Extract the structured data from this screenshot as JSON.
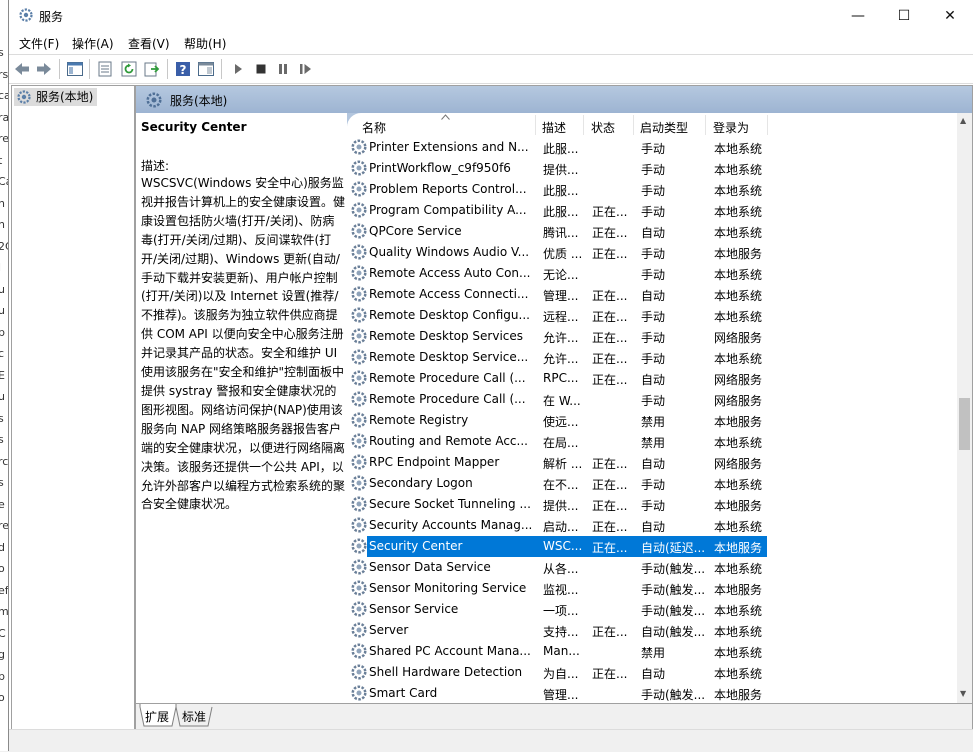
{
  "window": {
    "title": "服务",
    "minimize_glyph": "—",
    "maximize_glyph": "☐",
    "close_glyph": "✕"
  },
  "menu": [
    "文件(F)",
    "操作(A)",
    "查看(V)",
    "帮助(H)"
  ],
  "tree": {
    "root": "服务(本地)"
  },
  "panel": {
    "title": "服务(本地)"
  },
  "description": {
    "service_name": "Security Center",
    "label": "描述:",
    "text": "WSCSVC(Windows 安全中心)服务监视并报告计算机上的安全健康设置。健康设置包括防火墙(打开/关闭)、防病毒(打开/关闭/过期)、反间谍软件(打开/关闭/过期)、Windows 更新(自动/手动下载并安装更新)、用户帐户控制(打开/关闭)以及 Internet 设置(推荐/不推荐)。该服务为独立软件供应商提供 COM API 以便向安全中心服务注册并记录其产品的状态。安全和维护 UI 使用该服务在\"安全和维护\"控制面板中提供 systray 警报和安全健康状况的图形视图。网络访问保护(NAP)使用该服务向 NAP 网络策略服务器报告客户端的安全健康状况，以便进行网络隔离决策。该服务还提供一个公共 API，以允许外部客户以编程方式检索系统的聚合安全健康状况。"
  },
  "columns": {
    "name": "名称",
    "desc": "描述",
    "status": "状态",
    "startup": "启动类型",
    "logon": "登录为"
  },
  "services": [
    {
      "name": "Printer Extensions and N...",
      "desc": "此服...",
      "status": "",
      "startup": "手动",
      "logon": "本地系统"
    },
    {
      "name": "PrintWorkflow_c9f950f6",
      "desc": "提供...",
      "status": "",
      "startup": "手动",
      "logon": "本地系统"
    },
    {
      "name": "Problem Reports Control...",
      "desc": "此服...",
      "status": "",
      "startup": "手动",
      "logon": "本地系统"
    },
    {
      "name": "Program Compatibility A...",
      "desc": "此服...",
      "status": "正在...",
      "startup": "手动",
      "logon": "本地系统"
    },
    {
      "name": "QPCore Service",
      "desc": "腾讯...",
      "status": "正在...",
      "startup": "自动",
      "logon": "本地系统"
    },
    {
      "name": "Quality Windows Audio V...",
      "desc": "优质 ...",
      "status": "正在...",
      "startup": "手动",
      "logon": "本地服务"
    },
    {
      "name": "Remote Access Auto Con...",
      "desc": "无论...",
      "status": "",
      "startup": "手动",
      "logon": "本地系统"
    },
    {
      "name": "Remote Access Connecti...",
      "desc": "管理...",
      "status": "正在...",
      "startup": "自动",
      "logon": "本地系统"
    },
    {
      "name": "Remote Desktop Configu...",
      "desc": "远程...",
      "status": "正在...",
      "startup": "手动",
      "logon": "本地系统"
    },
    {
      "name": "Remote Desktop Services",
      "desc": "允许...",
      "status": "正在...",
      "startup": "手动",
      "logon": "网络服务"
    },
    {
      "name": "Remote Desktop Service...",
      "desc": "允许...",
      "status": "正在...",
      "startup": "手动",
      "logon": "本地系统"
    },
    {
      "name": "Remote Procedure Call (...",
      "desc": "RPC...",
      "status": "正在...",
      "startup": "自动",
      "logon": "网络服务"
    },
    {
      "name": "Remote Procedure Call (...",
      "desc": "在 W...",
      "status": "",
      "startup": "手动",
      "logon": "网络服务"
    },
    {
      "name": "Remote Registry",
      "desc": "使远...",
      "status": "",
      "startup": "禁用",
      "logon": "本地服务"
    },
    {
      "name": "Routing and Remote Acc...",
      "desc": "在局...",
      "status": "",
      "startup": "禁用",
      "logon": "本地系统"
    },
    {
      "name": "RPC Endpoint Mapper",
      "desc": "解析 ...",
      "status": "正在...",
      "startup": "自动",
      "logon": "网络服务"
    },
    {
      "name": "Secondary Logon",
      "desc": "在不...",
      "status": "正在...",
      "startup": "手动",
      "logon": "本地系统"
    },
    {
      "name": "Secure Socket Tunneling ...",
      "desc": "提供...",
      "status": "正在...",
      "startup": "手动",
      "logon": "本地服务"
    },
    {
      "name": "Security Accounts Manag...",
      "desc": "启动...",
      "status": "正在...",
      "startup": "自动",
      "logon": "本地系统"
    },
    {
      "name": "Security Center",
      "desc": "WSC...",
      "status": "正在...",
      "startup": "自动(延迟...",
      "logon": "本地服务"
    },
    {
      "name": "Sensor Data Service",
      "desc": "从各...",
      "status": "",
      "startup": "手动(触发...",
      "logon": "本地系统"
    },
    {
      "name": "Sensor Monitoring Service",
      "desc": "监视...",
      "status": "",
      "startup": "手动(触发...",
      "logon": "本地服务"
    },
    {
      "name": "Sensor Service",
      "desc": "一项...",
      "status": "",
      "startup": "手动(触发...",
      "logon": "本地系统"
    },
    {
      "name": "Server",
      "desc": "支持...",
      "status": "正在...",
      "startup": "自动(触发...",
      "logon": "本地系统"
    },
    {
      "name": "Shared PC Account Mana...",
      "desc": "Man...",
      "status": "",
      "startup": "禁用",
      "logon": "本地系统"
    },
    {
      "name": "Shell Hardware Detection",
      "desc": "为自...",
      "status": "正在...",
      "startup": "自动",
      "logon": "本地系统"
    },
    {
      "name": "Smart Card",
      "desc": "管理...",
      "status": "",
      "startup": "手动(触发...",
      "logon": "本地服务"
    }
  ],
  "selected_index": 19,
  "tabs": [
    "扩展",
    "标准"
  ],
  "left_edge_fragments": [
    "s",
    "rsi",
    "ca",
    "ra",
    "re",
    "t",
    "Ca",
    "h",
    "h",
    "2C",
    "l",
    "u",
    "u",
    "b",
    "c",
    "E",
    "u",
    "s",
    "s",
    "rc",
    "s",
    "e",
    "re",
    "d",
    "o",
    "ef",
    "m",
    "C",
    "g",
    "b",
    "o"
  ],
  "colors": {
    "selection": "#0078d7",
    "panel_header": "#b5c8df",
    "gear": "#5b7fa8"
  }
}
